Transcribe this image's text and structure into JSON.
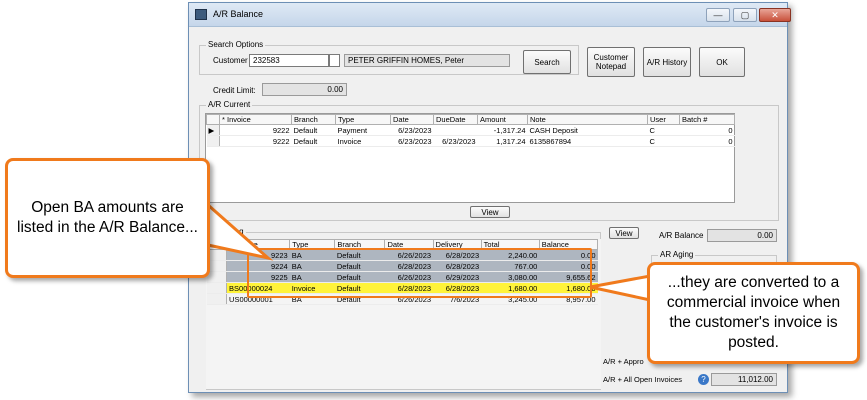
{
  "window": {
    "title": "A/R Balance",
    "controls": [
      "—",
      "▢",
      "✕"
    ]
  },
  "search": {
    "group_label": "Search Options",
    "customer_label": "Customer",
    "customer_value": "232583",
    "customer_name": "PETER GRIFFIN HOMES, Peter",
    "search_label": "Search",
    "notepad_label_1": "Customer",
    "notepad_label_2": "Notepad",
    "history_label": "A/R History",
    "ok_label": "OK",
    "credit_limit_label": "Credit Limit:",
    "credit_limit_value": "0.00"
  },
  "ar_current": {
    "group_label": "A/R Current",
    "headers": [
      "* Invoice",
      "Branch",
      "Type",
      "Date",
      "DueDate",
      "Amount",
      "Note",
      "User",
      "Batch #"
    ],
    "rows": [
      {
        "invoice": "9222",
        "branch": "Default",
        "type": "Payment",
        "date": "6/23/2023",
        "due": "",
        "amount": "-1,317.24",
        "note": "CASH  Deposit",
        "user": "C",
        "batch": "0"
      },
      {
        "invoice": "9222",
        "branch": "Default",
        "type": "Invoice",
        "date": "6/23/2023",
        "due": "6/23/2023",
        "amount": "1,317.24",
        "note": "6135867894",
        "user": "C",
        "batch": "0"
      }
    ],
    "view_label": "View"
  },
  "invoicing": {
    "group_label": "Invoicing",
    "headers": [
      "* Invoice",
      "Type",
      "Branch",
      "Date",
      "Delivery",
      "Total",
      "Balance"
    ],
    "rows": [
      {
        "invoice": "9223",
        "type": "BA",
        "branch": "Default",
        "date": "6/26/2023",
        "delivery": "6/28/2023",
        "total": "2,240.00",
        "balance": "0.00",
        "style": "gray"
      },
      {
        "invoice": "9224",
        "type": "BA",
        "branch": "Default",
        "date": "6/28/2023",
        "delivery": "6/28/2023",
        "total": "767.00",
        "balance": "0.00",
        "style": "gray"
      },
      {
        "invoice": "9225",
        "type": "BA",
        "branch": "Default",
        "date": "6/26/2023",
        "delivery": "6/29/2023",
        "total": "3,080.00",
        "balance": "9,655.62",
        "style": "gray"
      },
      {
        "invoice": "BS00000024",
        "type": "Invoice",
        "branch": "Default",
        "date": "6/28/2023",
        "delivery": "6/28/2023",
        "total": "1,680.00",
        "balance": "1,680.00",
        "style": "yellow"
      },
      {
        "invoice": "US00000001",
        "type": "BA",
        "branch": "Default",
        "date": "6/26/2023",
        "delivery": "7/6/2023",
        "total": "3,245.00",
        "balance": "8,957.00",
        "style": ""
      }
    ],
    "view_label": "View"
  },
  "summary": {
    "ar_balance_label": "A/R Balance",
    "ar_balance_value": "0.00",
    "ar_aging_label": "AR Aging",
    "approved_label": "A/R + Appro",
    "open_invoices_label": "A/R + All Open Invoices",
    "open_invoices_value": "11,012.00"
  },
  "callouts": {
    "left": "Open BA amounts are listed in the A/R Balance...",
    "right": "...they are converted to a commercial invoice when the customer's invoice is posted."
  },
  "colors": {
    "accent": "#f07a1c",
    "gray_row": "#aeb6c0",
    "yellow_row": "#fff33a"
  }
}
